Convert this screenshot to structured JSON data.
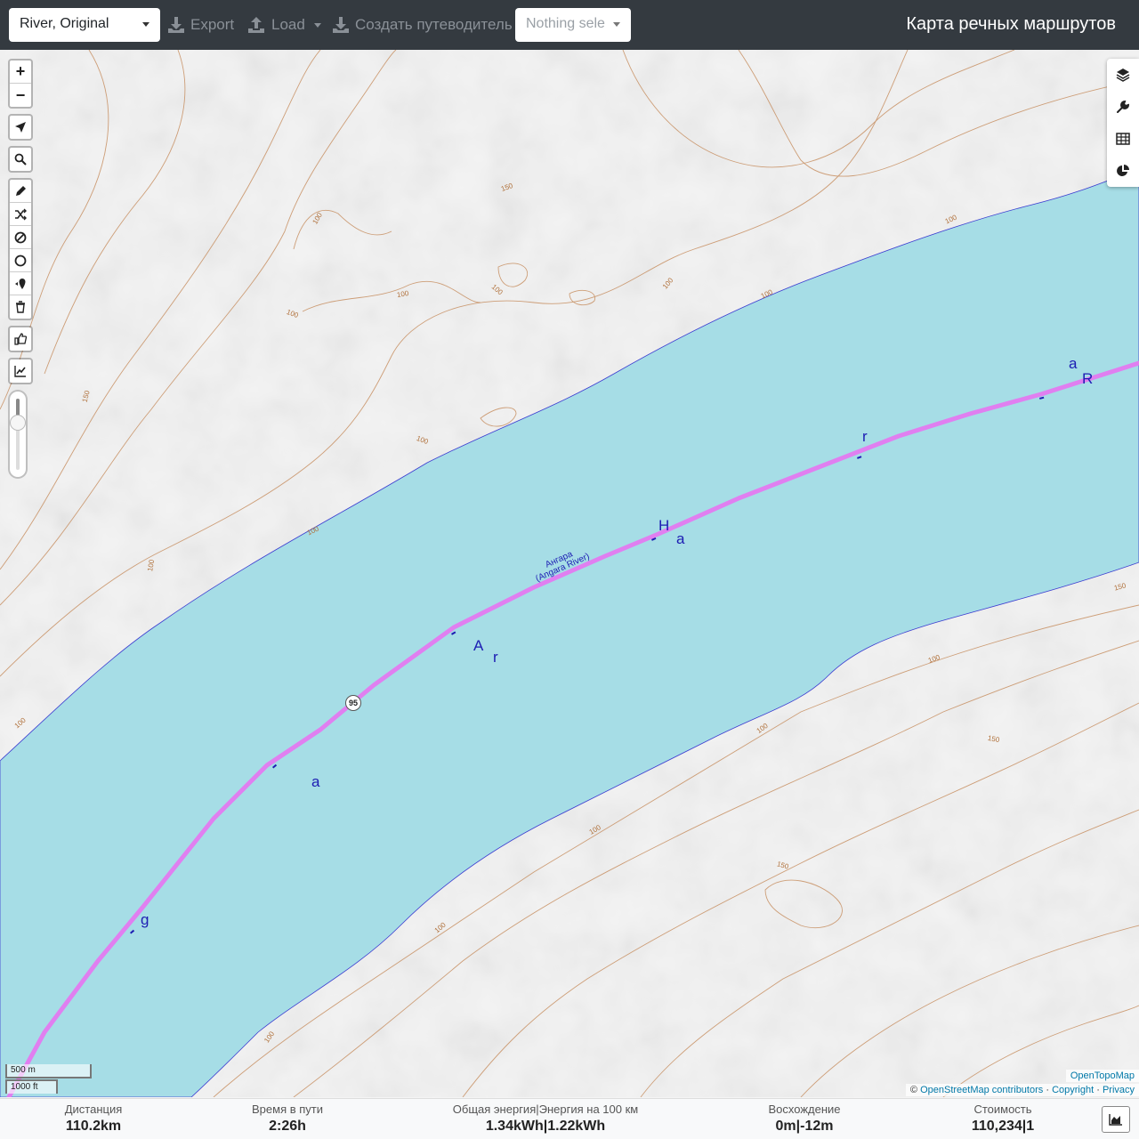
{
  "toolbar": {
    "profile_select": "River, Original",
    "export_label": "Export",
    "load_label": "Load",
    "guide_label": "Создать путеводитель",
    "selection_placeholder": "Nothing sele",
    "app_title": "Карта речных маршрутов"
  },
  "map": {
    "route_shield": "95",
    "river_name_ru": "Ангара",
    "river_name_en": "(Angara River)",
    "river_letters": [
      "a",
      "R",
      "r",
      "a",
      "H",
      "a",
      "A",
      "r",
      "a",
      "g"
    ],
    "contour_labels": [
      "150",
      "100",
      "100",
      "100",
      "100",
      "100",
      "100",
      "100",
      "150",
      "100",
      "100",
      "100",
      "100",
      "150",
      "100",
      "150",
      "100",
      "100",
      "150",
      "100",
      "100"
    ],
    "scale_metric": "500 m",
    "scale_imperial": "1000 ft",
    "attribution_tiles": "OpenTopoMap",
    "attribution_prefix": "©",
    "attribution_osm": "OpenStreetMap contributors",
    "attribution_copyright": "Copyright",
    "attribution_privacy": "Privacy",
    "attribution_sep": "·",
    "layer_opacity": 0.25
  },
  "left_controls": [
    "zoom-in",
    "zoom-out",
    "locate",
    "search",
    "draw-route",
    "reverse",
    "no-go",
    "circle",
    "poi",
    "delete",
    "feedback",
    "elevation"
  ],
  "right_controls": [
    "layers-icon",
    "settings-icon",
    "table-icon",
    "pie-chart-icon"
  ],
  "stats": {
    "distance_label": "Дистанция",
    "distance_value": "110.2",
    "distance_unit": "km",
    "time_label": "Время в пути",
    "time_value": "2:26",
    "time_unit": "h",
    "energy_label": "Общая энергия",
    "energy100_label": "Энергия на 100 км",
    "energy_value": "1.34",
    "energy_unit": "kWh",
    "energy100_value": "1.22",
    "energy100_unit": "kWh",
    "ascent_label": "Восхождение",
    "ascent_value": "0",
    "ascent_unit": "m",
    "descent_value": "-12",
    "descent_unit": "m",
    "cost_label": "Стоимость",
    "cost_value": "110,234",
    "cost_count": "1",
    "separator": "|"
  },
  "colors": {
    "navbar": "#343a40",
    "water": "#a6dde6",
    "route": "#e07ff0",
    "contour": "#b0703a",
    "river_text": "#1d1db3"
  }
}
